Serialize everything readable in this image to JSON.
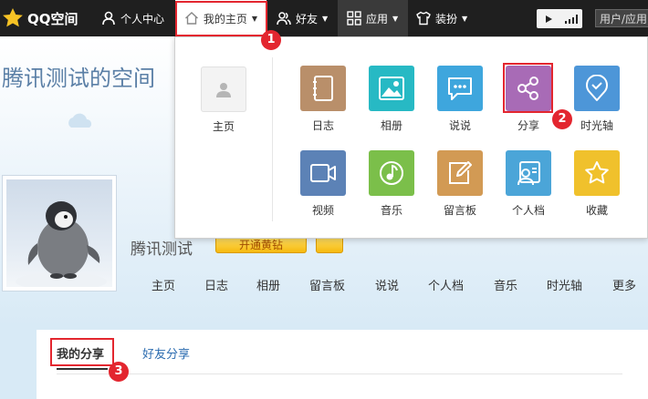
{
  "topbar": {
    "brand": "QQ空间",
    "personal_center": "个人中心",
    "my_home": "我的主页",
    "friends": "好友",
    "apps": "应用",
    "dress_up": "装扮",
    "user_app": "用户/应用"
  },
  "page": {
    "space_title": "腾讯测试的空间",
    "owner_name": "腾讯测试",
    "vip_label": "开通黄钻",
    "tabs": [
      "主页",
      "日志",
      "相册",
      "留言板",
      "说说",
      "个人档",
      "音乐",
      "时光轴",
      "更多"
    ],
    "share_tabs": {
      "mine": "我的分享",
      "friends": "好友分享"
    }
  },
  "dropdown": {
    "home_label": "主页",
    "apps": [
      {
        "label": "日志",
        "icon": "notebook-icon",
        "color": "#b98f6a"
      },
      {
        "label": "相册",
        "icon": "photo-icon",
        "color": "#27b9c4"
      },
      {
        "label": "说说",
        "icon": "chat-bubble-icon",
        "color": "#3ea6dd"
      },
      {
        "label": "分享",
        "icon": "share-icon",
        "color": "#a86bb6"
      },
      {
        "label": "时光轴",
        "icon": "location-clock-icon",
        "color": "#4d96d8"
      },
      {
        "label": "视频",
        "icon": "video-camera-icon",
        "color": "#5c82b6"
      },
      {
        "label": "音乐",
        "icon": "music-note-icon",
        "color": "#7bbf4a"
      },
      {
        "label": "留言板",
        "icon": "edit-icon",
        "color": "#d29a54"
      },
      {
        "label": "个人档",
        "icon": "profile-card-icon",
        "color": "#4ba5d8"
      },
      {
        "label": "收藏",
        "icon": "star-icon",
        "color": "#f0c12c"
      }
    ]
  },
  "annotations": [
    "1",
    "2",
    "3"
  ],
  "colors": {
    "annotation_red": "#e3262f",
    "topbar": "#1f1f1f"
  }
}
